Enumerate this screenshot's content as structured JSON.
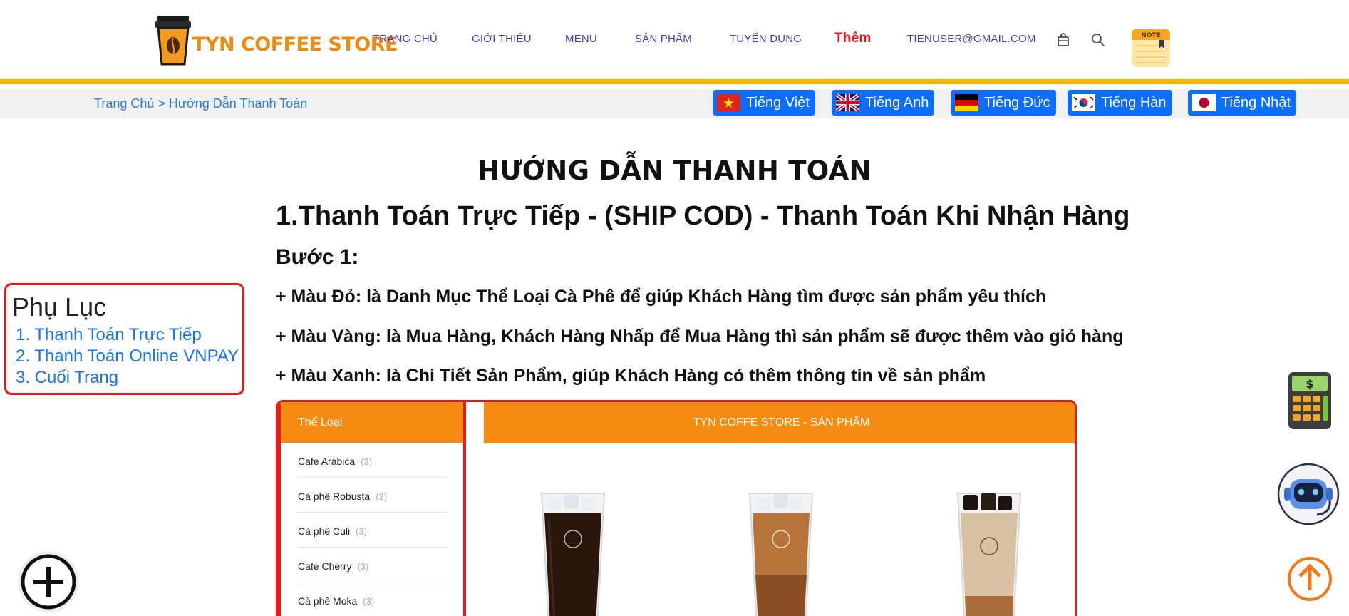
{
  "header": {
    "logo_text": "TYN COFFEE STORE",
    "nav": {
      "home": "TRANG CHỦ",
      "about": "GIỚI THIỆU",
      "menu": "MENU",
      "products": "SẢN PHẨM",
      "jobs": "TUYỂN DỤNG",
      "more": "Thêm",
      "email": "TIENUSER@GMAIL.COM"
    },
    "note_label": "NOTE",
    "icons": [
      "cart-icon",
      "search-icon",
      "note-icon"
    ]
  },
  "breadcrumb": "Trang Chủ > Hướng Dẫn Thanh Toán",
  "languages": {
    "vi": "Tiếng Việt",
    "en": "Tiếng Anh",
    "de": "Tiếng Đức",
    "ko": "Tiếng Hàn",
    "ja": "Tiếng Nhật"
  },
  "content": {
    "title": "HƯỚNG DẪN THANH TOÁN",
    "section_1": "1.Thanh Toán Trực Tiếp - (SHIP COD) - Thanh Toán Khi Nhận Hàng",
    "step_1": "Bước 1:",
    "bullets": [
      "+ Màu Đỏ: là Danh Mục Thể Loại Cà Phê để giúp Khách Hàng tìm được sản phẩm yêu thích",
      "+ Màu Vàng: là Mua Hàng, Khách Hàng Nhấp để Mua Hàng thì sản phẩm sẽ được thêm vào giỏ hàng",
      "+ Màu Xanh: là Chi Tiết Sản Phẩm, giúp Khách Hàng có thêm thông tin về sản phẩm"
    ]
  },
  "appendix": {
    "title": "Phụ Lục",
    "links": [
      "1. Thanh Toán Trực Tiếp",
      "2. Thanh Toán Online VNPAY",
      "3. Cuối Trang"
    ]
  },
  "demo": {
    "category_header": "Thể Loại",
    "categories": [
      {
        "name": "Cafe Arabica",
        "count": "(3)"
      },
      {
        "name": "Cà phê Robusta",
        "count": "(3)"
      },
      {
        "name": "Cà phê Culi",
        "count": "(3)"
      },
      {
        "name": "Cafe Cherry",
        "count": "(3)"
      },
      {
        "name": "Cà phê Moka",
        "count": "(3)"
      }
    ],
    "products_header": "TYN COFFE STORE - SẢN PHẨM"
  },
  "colors": {
    "brand_orange": "#f68b13",
    "highlight_red": "#e31b1b",
    "header_rule": "#f2b705",
    "lang_button": "#0d6efd",
    "nav_link": "#3b3fb5"
  }
}
